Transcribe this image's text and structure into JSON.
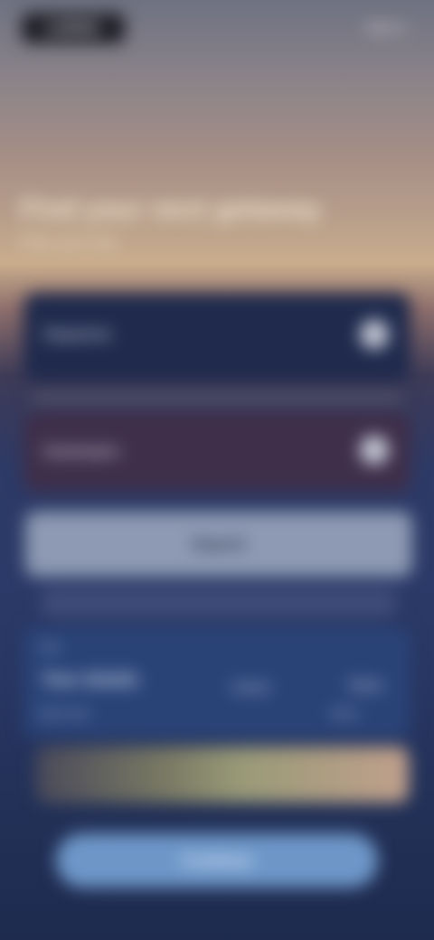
{
  "topbar": {
    "logo": "LOGO",
    "signin": "Sign in"
  },
  "hero": {
    "title": "Find your next getaway",
    "subtitle": "Plan your trip"
  },
  "form": {
    "field1_label": "Departure",
    "field2_label": "Destination",
    "search_label": "Search"
  },
  "info": {
    "small1": "Info",
    "lead": "Your details",
    "tag": "Details",
    "val": "Value",
    "small2": "More info",
    "val2": "More"
  },
  "cta": {
    "label": "Continue"
  },
  "colors": {
    "background_top": "#6f7282",
    "background_bottom": "#1e2b4f",
    "card_primary": "#1f2a4d",
    "card_secondary": "#3f2f4a",
    "cta": "#6e97c8"
  },
  "icons": {
    "field1": "chevron-icon",
    "field2": "chevron-icon"
  }
}
